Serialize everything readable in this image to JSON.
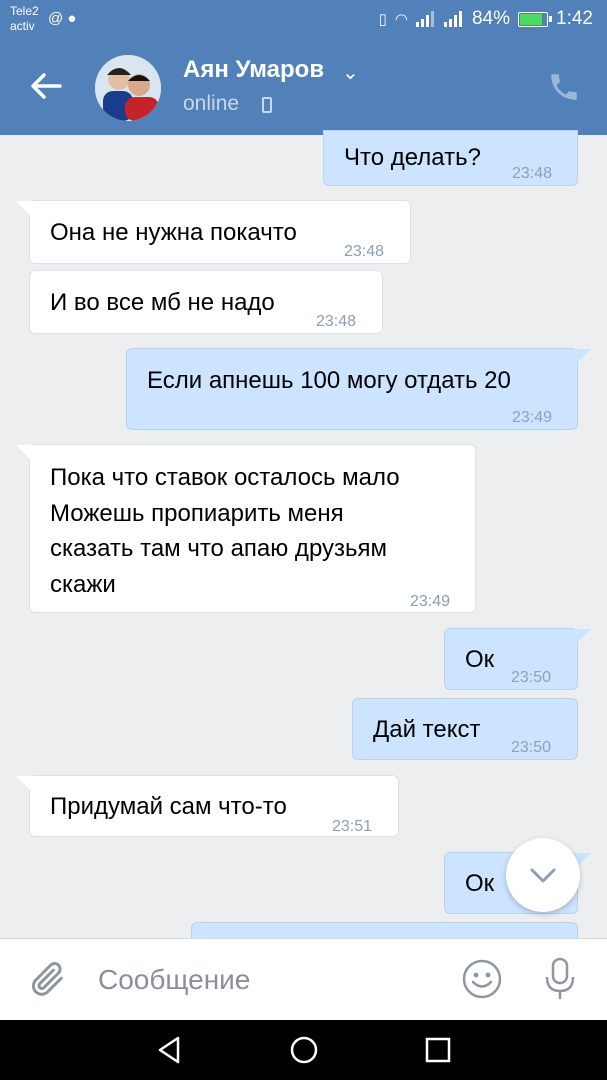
{
  "status_bar": {
    "carrier": "Tele2",
    "carrier_sub": "activ",
    "battery": "84%",
    "time": "1:42"
  },
  "header": {
    "contact_name": "Аян Умаров",
    "contact_status": "online"
  },
  "messages": [
    {
      "direction": "out",
      "text": "Что делать?",
      "time": "23:48"
    },
    {
      "direction": "in",
      "text": "Она не нужна покачто",
      "time": "23:48"
    },
    {
      "direction": "in",
      "text": "И во все мб не надо",
      "time": "23:48"
    },
    {
      "direction": "out",
      "text": "Если апнешь 100 могу отдать 20",
      "time": "23:49"
    },
    {
      "direction": "in",
      "lines": [
        "Пока что ставок осталось мало",
        "Можешь пропиарить меня",
        "сказать там что апаю друзьям",
        "скажи"
      ],
      "time": "23:49"
    },
    {
      "direction": "out",
      "text": "Ок",
      "time": "23:50"
    },
    {
      "direction": "out",
      "text": "Дай текст",
      "time": "23:50"
    },
    {
      "direction": "in",
      "text": "Придумай сам что-то",
      "time": "23:51"
    },
    {
      "direction": "out",
      "text": "Ок",
      "time": ""
    }
  ],
  "composer": {
    "placeholder": "Сообщение"
  },
  "colors": {
    "header": "#5181b8",
    "outgoing_bubble": "#cce4ff",
    "incoming_bubble": "#ffffff",
    "chat_background": "#edeef0"
  }
}
